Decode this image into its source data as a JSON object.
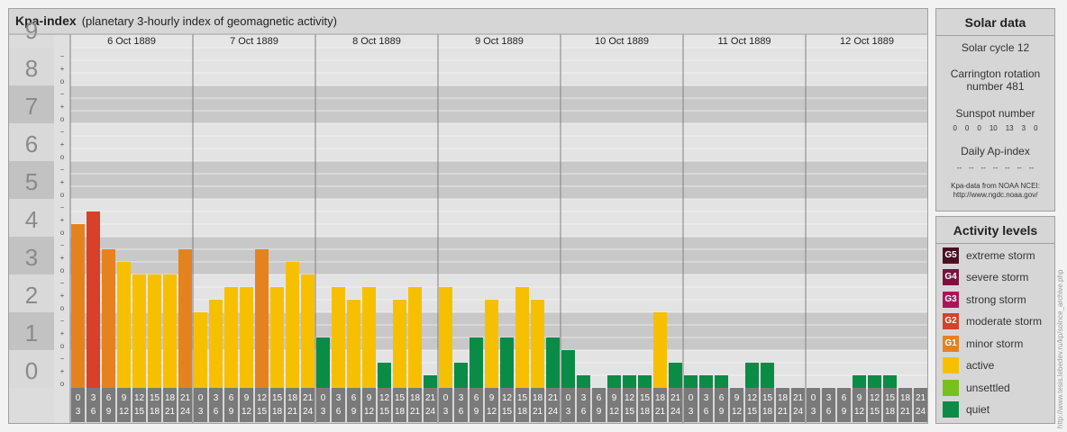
{
  "chart_data": {
    "type": "bar",
    "title": "Kpa-index",
    "subtitle": "(planetary 3-hourly index of geomagnetic activity)",
    "ylim": [
      0,
      9
    ],
    "y_ticks": [
      "0",
      "1",
      "2",
      "3",
      "4",
      "5",
      "6",
      "7",
      "8",
      "9"
    ],
    "minor_marks": [
      "o",
      "+",
      "−"
    ],
    "days": [
      "6 Oct 1889",
      "7 Oct 1889",
      "8 Oct 1889",
      "9 Oct 1889",
      "10 Oct 1889",
      "11 Oct 1889",
      "12 Oct 1889"
    ],
    "interval_start": [
      "0",
      "3",
      "6",
      "9",
      "12",
      "15",
      "18",
      "21"
    ],
    "interval_end": [
      "3",
      "6",
      "9",
      "12",
      "15",
      "18",
      "21",
      "24"
    ],
    "values": [
      [
        4.333,
        4.667,
        3.667,
        3.333,
        3.0,
        3.0,
        3.0,
        3.667
      ],
      [
        2.0,
        2.333,
        2.667,
        2.667,
        3.667,
        2.667,
        3.333,
        3.0
      ],
      [
        1.333,
        2.667,
        2.333,
        2.667,
        0.667,
        2.333,
        2.667,
        0.333
      ],
      [
        2.667,
        0.667,
        1.333,
        2.333,
        1.333,
        2.667,
        2.333,
        1.333
      ],
      [
        1.0,
        0.333,
        0.0,
        0.333,
        0.333,
        0.333,
        2.0,
        0.667
      ],
      [
        0.333,
        0.333,
        0.333,
        0.0,
        0.667,
        0.667,
        0.0,
        0.0
      ],
      [
        0.0,
        0.0,
        0.0,
        0.333,
        0.333,
        0.333,
        0.0,
        0.0
      ]
    ],
    "levels": [
      [
        4,
        5,
        4,
        3,
        3,
        3,
        3,
        4
      ],
      [
        3,
        3,
        3,
        3,
        4,
        3,
        3,
        3
      ],
      [
        2,
        3,
        3,
        3,
        2,
        3,
        3,
        2
      ],
      [
        3,
        2,
        2,
        3,
        2,
        3,
        3,
        2
      ],
      [
        2,
        2,
        2,
        2,
        2,
        2,
        3,
        2
      ],
      [
        2,
        2,
        2,
        2,
        2,
        2,
        2,
        2
      ],
      [
        2,
        2,
        2,
        2,
        2,
        2,
        2,
        2
      ]
    ]
  },
  "solar": {
    "heading": "Solar data",
    "cycle": "Solar cycle 12",
    "carrington_line1": "Carrington rotation",
    "carrington_line2": "number 481",
    "sunspot_label": "Sunspot number",
    "sunspots": [
      "0",
      "0",
      "0",
      "10",
      "13",
      "3",
      "0"
    ],
    "ap_label": "Daily Ap-index",
    "ap_values": [
      "--",
      "--",
      "--",
      "--",
      "--",
      "--",
      "--"
    ],
    "source_line1": "Kpa-data from NOAA NCEI:",
    "source_line2": "http://www.ngdc.noaa.gov/"
  },
  "activity": {
    "heading": "Activity levels",
    "items": [
      {
        "code": "G5",
        "label": "extreme storm",
        "color": "#4a0f24"
      },
      {
        "code": "G4",
        "label": "severe storm",
        "color": "#7a1240"
      },
      {
        "code": "G3",
        "label": "strong storm",
        "color": "#b0125c"
      },
      {
        "code": "G2",
        "label": "moderate storm",
        "color": "#d8402a"
      },
      {
        "code": "G1",
        "label": "minor storm",
        "color": "#e6821e"
      },
      {
        "code": "",
        "label": "active",
        "color": "#f6c000"
      },
      {
        "code": "",
        "label": "unsettled",
        "color": "#78c01e"
      },
      {
        "code": "",
        "label": "quiet",
        "color": "#0a8c46"
      }
    ]
  },
  "credit": "http://www.tesis.lebedev.ru/kp/solnce_archive.php"
}
